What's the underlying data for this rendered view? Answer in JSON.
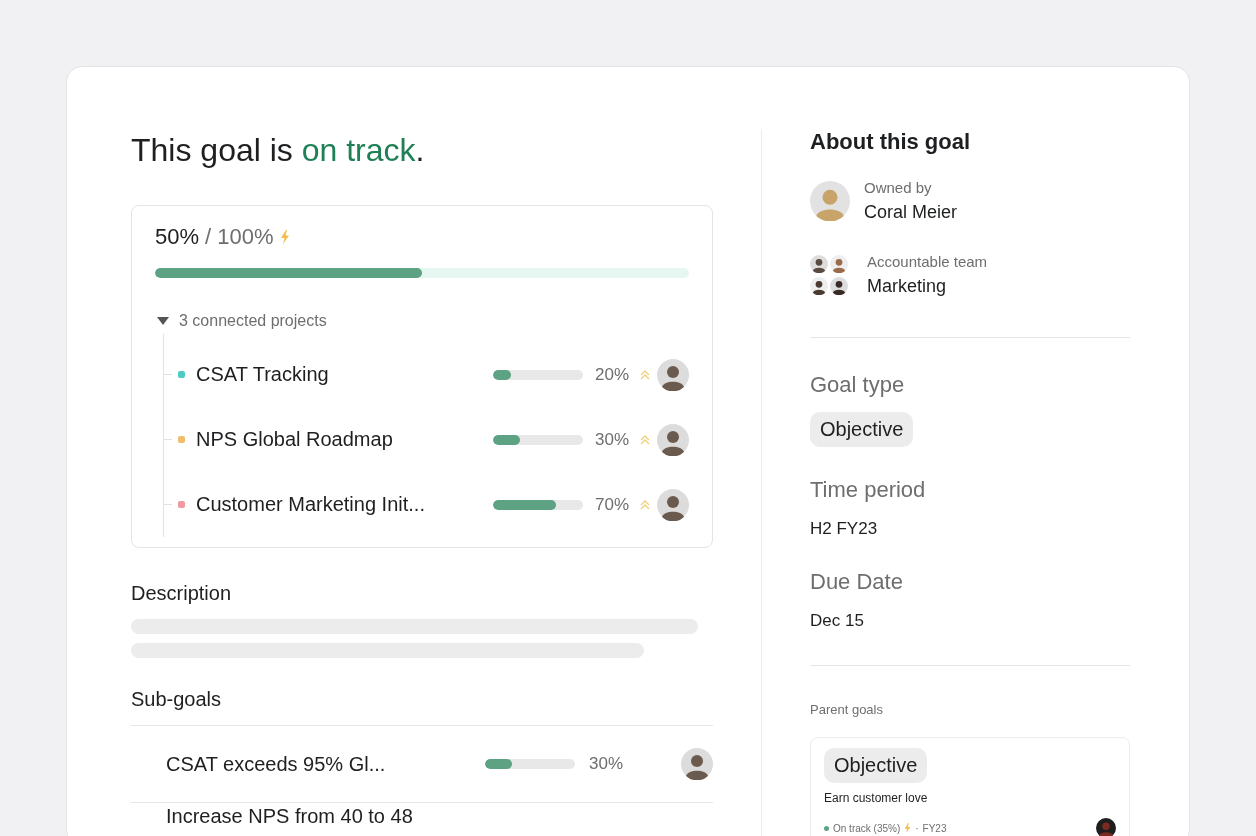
{
  "heading": {
    "text": "This goal is ",
    "status": "on track",
    "suffix": "."
  },
  "progress": {
    "value": "50%",
    "total": "/ 100%",
    "level": 0.5
  },
  "projects": {
    "label": "3 connected projects",
    "expanded": true,
    "items": [
      {
        "name": "CSAT Tracking",
        "color": "#4ecbc4",
        "level": 0.2,
        "percent": "20%"
      },
      {
        "name": "NPS Global Roadmap",
        "color": "#f1bd6c",
        "level": 0.3,
        "percent": "30%"
      },
      {
        "name": "Customer Marketing Init...",
        "color": "#f09aa0",
        "level": 0.7,
        "percent": "70%"
      }
    ]
  },
  "description": {
    "title": "Description"
  },
  "subgoals": {
    "title": "Sub-goals",
    "items": [
      {
        "name": "CSAT exceeds 95% Gl...",
        "level": 0.3,
        "percent": "30%"
      },
      {
        "name": "Increase NPS from 40 to 48"
      }
    ]
  },
  "about": {
    "title": "About this goal",
    "owner": {
      "label": "Owned by",
      "name": "Coral Meier"
    },
    "team": {
      "label": "Accountable team",
      "name": "Marketing"
    },
    "fields": [
      {
        "label": "Goal type",
        "value": "Objective",
        "kind": "chip"
      },
      {
        "label": "Time period",
        "value": "H2 FY23",
        "kind": "text"
      },
      {
        "label": "Due Date",
        "value": "Dec 15",
        "kind": "text"
      }
    ],
    "parent": {
      "label": "Parent goals",
      "type": "Objective",
      "title": "Earn customer love",
      "status": "On track (35%)",
      "color": "#5da283",
      "separator": "·",
      "period": "FY23"
    }
  }
}
